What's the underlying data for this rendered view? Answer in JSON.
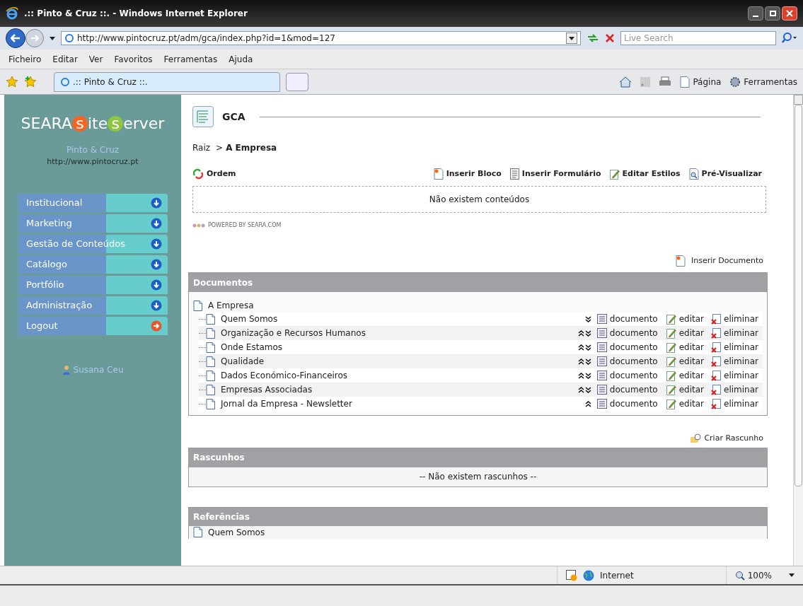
{
  "window": {
    "title": ".:: Pinto & Cruz ::. - Windows Internet Explorer"
  },
  "address_bar": {
    "url": "http://www.pintocruz.pt/adm/gca/index.php?id=1&mod=127",
    "search_placeholder": "Live Search"
  },
  "menu": [
    "Ficheiro",
    "Editar",
    "Ver",
    "Favoritos",
    "Ferramentas",
    "Ajuda"
  ],
  "tabs": [
    {
      "label": ".:: Pinto & Cruz ::.",
      "selected": true
    }
  ],
  "command_bar": [
    "Página",
    "Ferramentas"
  ],
  "sidebar": {
    "logo": [
      {
        "text": "SEARA"
      },
      {
        "text": "s",
        "color": "#f26522"
      },
      {
        "text": "ite"
      },
      {
        "text": "s",
        "color": "#8dc63f"
      },
      {
        "text": "erver"
      }
    ],
    "site_name": "Pinto & Cruz",
    "site_url": "http://www.pintocruz.pt",
    "items": [
      {
        "label": "Institucional",
        "kind": "expand"
      },
      {
        "label": "Marketing",
        "kind": "expand"
      },
      {
        "label": "Gestão de Conteúdos",
        "kind": "expand"
      },
      {
        "label": "Catálogo",
        "kind": "expand"
      },
      {
        "label": "Portfólio",
        "kind": "expand"
      },
      {
        "label": "Administração",
        "kind": "expand"
      },
      {
        "label": "Logout",
        "kind": "exit"
      }
    ],
    "user": "Susana Ceu"
  },
  "page": {
    "title": "GCA",
    "breadcrumb": {
      "root": "Raiz",
      "separator": ">",
      "current": "A Empresa"
    },
    "order_label": "Ordem",
    "toolbar": [
      {
        "label": "Inserir Bloco",
        "kind": "block"
      },
      {
        "label": "Inserir Formulário",
        "kind": "form"
      },
      {
        "label": "Editar Estilos",
        "kind": "edit"
      },
      {
        "label": "Pré-Visualizar",
        "kind": "preview"
      }
    ],
    "empty_content": "Não existem conteúdos",
    "powered_by": "POWERED BY SEARA.COM",
    "insert_document": "Inserir Documento",
    "documents": {
      "title": "Documentos",
      "root": "A Empresa",
      "rows": [
        {
          "name": "Quem Somos",
          "move_up": false,
          "move_down": true,
          "view": "documento",
          "edit": "editar",
          "delete": "eliminar"
        },
        {
          "name": "Organização e Recursos Humanos",
          "move_up": true,
          "move_down": true,
          "view": "documento",
          "edit": "editar",
          "delete": "eliminar"
        },
        {
          "name": "Onde Estamos",
          "move_up": true,
          "move_down": true,
          "view": "documento",
          "edit": "editar",
          "delete": "eliminar"
        },
        {
          "name": "Qualidade",
          "move_up": true,
          "move_down": true,
          "view": "documento",
          "edit": "editar",
          "delete": "eliminar"
        },
        {
          "name": "Dados Económico-Financeiros",
          "move_up": true,
          "move_down": true,
          "view": "documento",
          "edit": "editar",
          "delete": "eliminar"
        },
        {
          "name": "Empresas Associadas",
          "move_up": true,
          "move_down": true,
          "view": "documento",
          "edit": "editar",
          "delete": "eliminar"
        },
        {
          "name": "Jornal da Empresa - Newsletter",
          "move_up": true,
          "move_down": false,
          "view": "documento",
          "edit": "editar",
          "delete": "eliminar"
        }
      ]
    },
    "create_draft": "Criar Rascunho",
    "drafts": {
      "title": "Rascunhos",
      "empty": "-- Não existem rascunhos --"
    },
    "references": {
      "title": "Referências",
      "rows": [
        "Quem Somos"
      ]
    }
  },
  "status_bar": {
    "zone": "Internet",
    "zoom": "100%"
  }
}
